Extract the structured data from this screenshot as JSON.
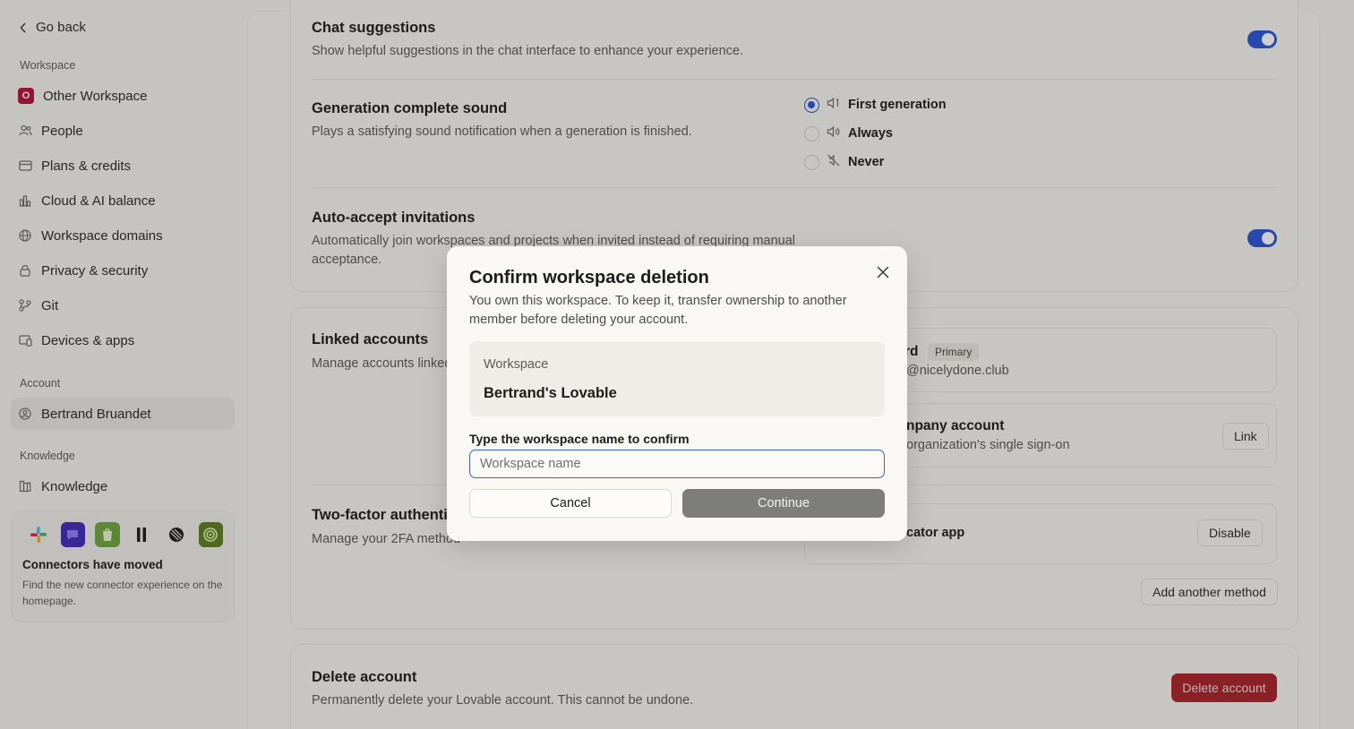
{
  "sidebar": {
    "go_back": "Go back",
    "sections": {
      "workspace": "Workspace",
      "account": "Account",
      "knowledge": "Knowledge"
    },
    "workspace_badge": "O",
    "workspace_items": [
      {
        "label": "Other Workspace",
        "icon": "workspace-badge"
      },
      {
        "label": "People",
        "icon": "people-icon"
      },
      {
        "label": "Plans & credits",
        "icon": "credit-card-icon"
      },
      {
        "label": "Cloud & AI balance",
        "icon": "chart-icon"
      },
      {
        "label": "Workspace domains",
        "icon": "globe-icon"
      },
      {
        "label": "Privacy & security",
        "icon": "lock-icon"
      },
      {
        "label": "Git",
        "icon": "git-icon"
      },
      {
        "label": "Devices & apps",
        "icon": "devices-icon"
      }
    ],
    "account_items": [
      {
        "label": "Bertrand Bruandet",
        "icon": "user-circle-icon"
      }
    ],
    "knowledge_items": [
      {
        "label": "Knowledge",
        "icon": "book-icon"
      }
    ],
    "connectors": {
      "title": "Connectors have moved",
      "description": "Find the new connector experience on the homepage."
    }
  },
  "settings": {
    "chat_suggestions": {
      "title": "Chat suggestions",
      "description": "Show helpful suggestions in the chat interface to enhance your experience."
    },
    "generation_sound": {
      "title": "Generation complete sound",
      "description": "Plays a satisfying sound notification when a generation is finished.",
      "options": [
        "First generation",
        "Always",
        "Never"
      ],
      "selected": "First generation"
    },
    "auto_accept": {
      "title": "Auto-accept invitations",
      "description": "Automatically join workspaces and projects when invited instead of requiring manual acceptance."
    },
    "linked_accounts": {
      "title": "Linked accounts",
      "description": "Manage accounts linked",
      "account_name_fragment": "rd",
      "primary_badge": "Primary",
      "email_fragment": "@nicelydone.club",
      "company_title_fragment": "npany account",
      "company_desc_fragment": "organization's single sign-on",
      "link_button": "Link"
    },
    "two_factor": {
      "title": "Two-factor authentic",
      "description": "Manage your 2FA method",
      "method_fragment": "cator app",
      "disable_button": "Disable",
      "add_method_button": "Add another method"
    },
    "delete_account": {
      "title": "Delete account",
      "description": "Permanently delete your Lovable account. This cannot be undone.",
      "button": "Delete account"
    }
  },
  "modal": {
    "title": "Confirm workspace deletion",
    "description": "You own this workspace. To keep it, transfer ownership to another member before deleting your account.",
    "workspace_label": "Workspace",
    "workspace_name": "Bertrand's Lovable",
    "field_label": "Type the workspace name to confirm",
    "input_placeholder": "Workspace name",
    "input_value": "",
    "cancel": "Cancel",
    "continue": "Continue"
  },
  "colors": {
    "accent": "#2a55d6",
    "danger": "#a9222b",
    "workspace_badge": "#b3123f"
  }
}
